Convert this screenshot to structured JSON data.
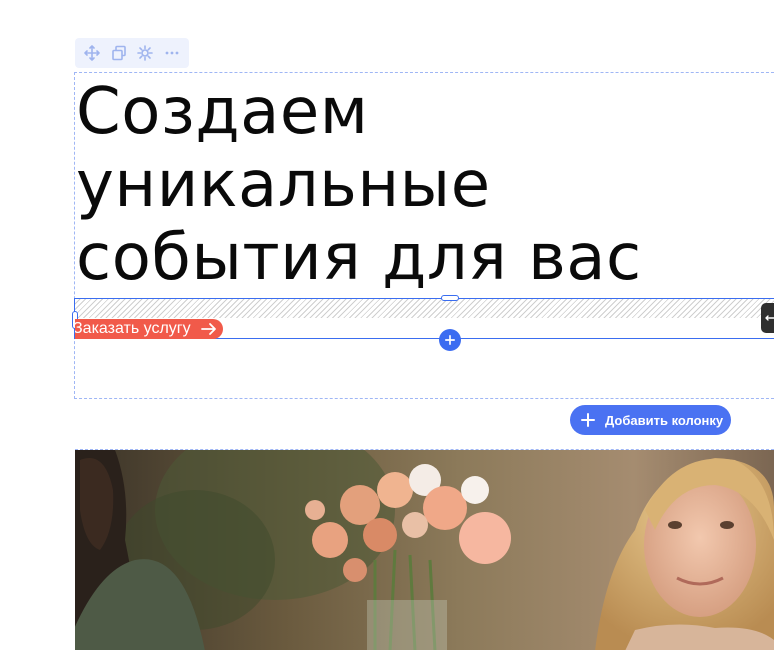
{
  "block": {
    "heading_line1": "Создаем",
    "heading_line2": "уникальные",
    "heading_line3": "события для вас",
    "cta_label": "Заказать услугу"
  },
  "editor": {
    "add_column_label": "Добавить колонку",
    "toolbar_icons": [
      "move-icon",
      "duplicate-icon",
      "settings-icon",
      "more-icon"
    ]
  },
  "colors": {
    "accent_blue": "#3b6cf1",
    "cta_red": "#f15a4a",
    "heading_text": "#0a0a0a"
  }
}
